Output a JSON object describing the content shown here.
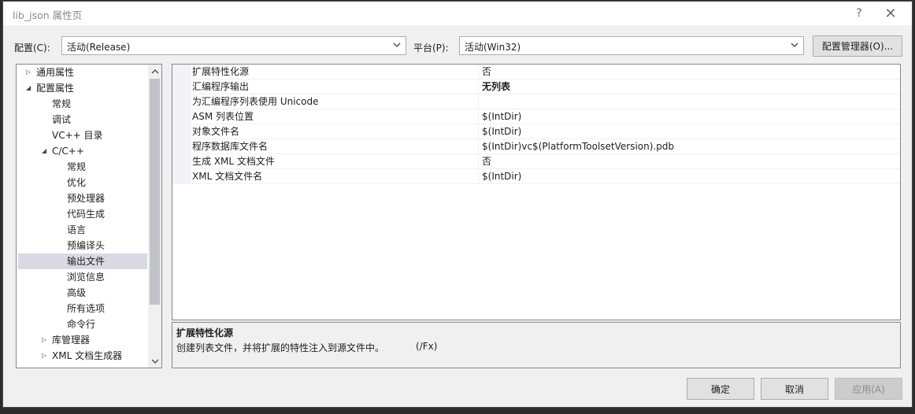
{
  "window": {
    "title": "lib_json 属性页",
    "help_glyph": "?",
    "close_glyph": "✕"
  },
  "toolbar": {
    "config_label": "配置(C):",
    "config_value": "活动(Release)",
    "platform_label": "平台(P):",
    "platform_value": "活动(Win32)",
    "config_manager_label": "配置管理器(O)..."
  },
  "tree": {
    "items": [
      {
        "label": "通用属性",
        "level": 0,
        "expander": "▷"
      },
      {
        "label": "配置属性",
        "level": 0,
        "expander": "◢"
      },
      {
        "label": "常规",
        "level": 1,
        "expander": ""
      },
      {
        "label": "调试",
        "level": 1,
        "expander": ""
      },
      {
        "label": "VC++ 目录",
        "level": 1,
        "expander": ""
      },
      {
        "label": "C/C++",
        "level": 1,
        "expander": "◢"
      },
      {
        "label": "常规",
        "level": 2,
        "expander": ""
      },
      {
        "label": "优化",
        "level": 2,
        "expander": ""
      },
      {
        "label": "预处理器",
        "level": 2,
        "expander": ""
      },
      {
        "label": "代码生成",
        "level": 2,
        "expander": ""
      },
      {
        "label": "语言",
        "level": 2,
        "expander": ""
      },
      {
        "label": "预编译头",
        "level": 2,
        "expander": ""
      },
      {
        "label": "输出文件",
        "level": 2,
        "expander": "",
        "selected": true
      },
      {
        "label": "浏览信息",
        "level": 2,
        "expander": ""
      },
      {
        "label": "高级",
        "level": 2,
        "expander": ""
      },
      {
        "label": "所有选项",
        "level": 2,
        "expander": ""
      },
      {
        "label": "命令行",
        "level": 2,
        "expander": ""
      },
      {
        "label": "库管理器",
        "level": 1,
        "expander": "▷"
      },
      {
        "label": "XML 文档生成器",
        "level": 1,
        "expander": "▷"
      }
    ]
  },
  "properties": {
    "rows": [
      {
        "name": "扩展特性化源",
        "value": "否",
        "bold": false
      },
      {
        "name": "汇编程序输出",
        "value": "无列表",
        "bold": true
      },
      {
        "name": "为汇编程序列表使用 Unicode",
        "value": "",
        "bold": false
      },
      {
        "name": "ASM 列表位置",
        "value": "$(IntDir)",
        "bold": false
      },
      {
        "name": "对象文件名",
        "value": "$(IntDir)",
        "bold": false
      },
      {
        "name": "程序数据库文件名",
        "value": "$(IntDir)vc$(PlatformToolsetVersion).pdb",
        "bold": false
      },
      {
        "name": "生成 XML 文档文件",
        "value": "否",
        "bold": false
      },
      {
        "name": "XML 文档文件名",
        "value": "$(IntDir)",
        "bold": false
      }
    ]
  },
  "description": {
    "title": "扩展特性化源",
    "text": "创建列表文件，并将扩展的特性注入到源文件中。",
    "switch": "/Fx"
  },
  "footer": {
    "ok_label": "确定",
    "cancel_label": "取消",
    "apply_label": "应用(A)"
  }
}
